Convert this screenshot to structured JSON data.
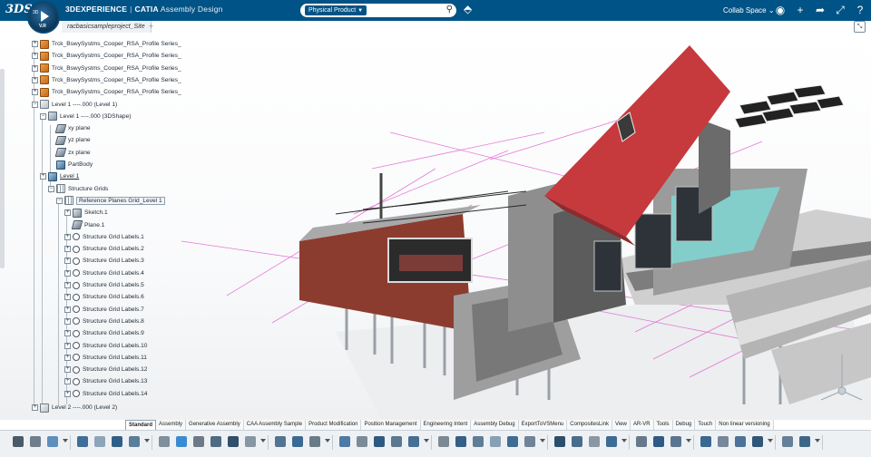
{
  "header": {
    "logo_text": "3DS",
    "compass_top": "3D",
    "compass_bottom": "V.R",
    "brand": "3DEXPERIENCE",
    "app": "CATIA",
    "workbench": "Assembly Design",
    "search_scope": "Physical Product",
    "collab_space": "Collab Space",
    "icons": [
      "user-icon",
      "plus-icon",
      "share-icon",
      "arrows-icon",
      "help-icon"
    ]
  },
  "tabs": {
    "active_tab": "racbasicsampleproject_Site",
    "add_label": "+"
  },
  "tree": {
    "nodes": [
      {
        "label": "Trck_BswySystms_Cooper_RSA_Profile Series_",
        "icon": "product",
        "expander": "+"
      },
      {
        "label": "Trck_BswySystms_Cooper_RSA_Profile Series_",
        "icon": "product",
        "expander": "+"
      },
      {
        "label": "Trck_BswySystms_Cooper_RSA_Profile Series_",
        "icon": "product",
        "expander": "+"
      },
      {
        "label": "Trck_BswySystms_Cooper_RSA_Profile Series_",
        "icon": "product",
        "expander": "+"
      },
      {
        "label": "Trck_BswySystms_Cooper_RSA_Profile Series_",
        "icon": "product",
        "expander": "+"
      },
      {
        "label": "Level 1 ----.000 (Level 1)",
        "icon": "product-small",
        "expander": "−"
      },
      {
        "label": "Level 1 ----.000 (3DShape)",
        "icon": "shape",
        "expander": "−"
      },
      {
        "label": "xy plane",
        "icon": "plane",
        "expander": ""
      },
      {
        "label": "yz plane",
        "icon": "plane",
        "expander": ""
      },
      {
        "label": "zx plane",
        "icon": "plane",
        "expander": ""
      },
      {
        "label": "PartBody",
        "icon": "body",
        "expander": ""
      },
      {
        "label": "Level 1",
        "icon": "body",
        "expander": "+"
      },
      {
        "label": "Structure Grids",
        "icon": "grid",
        "expander": "−"
      },
      {
        "label": "Reference Planes Grid_Level 1",
        "icon": "grid",
        "expander": "−"
      },
      {
        "label": "Sketch.1",
        "icon": "sketch",
        "expander": "+"
      },
      {
        "label": "Plane.1",
        "icon": "plane",
        "expander": ""
      },
      {
        "label": "Structure Grid Labels.1",
        "icon": "label",
        "expander": "+"
      },
      {
        "label": "Structure Grid Labels.2",
        "icon": "label",
        "expander": "+"
      },
      {
        "label": "Structure Grid Labels.3",
        "icon": "label",
        "expander": "+"
      },
      {
        "label": "Structure Grid Labels.4",
        "icon": "label",
        "expander": "+"
      },
      {
        "label": "Structure Grid Labels.5",
        "icon": "label",
        "expander": "+"
      },
      {
        "label": "Structure Grid Labels.6",
        "icon": "label",
        "expander": "+"
      },
      {
        "label": "Structure Grid Labels.7",
        "icon": "label",
        "expander": "+"
      },
      {
        "label": "Structure Grid Labels.8",
        "icon": "label",
        "expander": "+"
      },
      {
        "label": "Structure Grid Labels.9",
        "icon": "label",
        "expander": "+"
      },
      {
        "label": "Structure Grid Labels.10",
        "icon": "label",
        "expander": "+"
      },
      {
        "label": "Structure Grid Labels.11",
        "icon": "label",
        "expander": "+"
      },
      {
        "label": "Structure Grid Labels.12",
        "icon": "label",
        "expander": "+"
      },
      {
        "label": "Structure Grid Labels.13",
        "icon": "label",
        "expander": "+"
      },
      {
        "label": "Structure Grid Labels.14",
        "icon": "label",
        "expander": "+"
      },
      {
        "label": "Level 2 ----.000 (Level 2)",
        "icon": "product-small",
        "expander": "+"
      }
    ]
  },
  "workbench_tabs": [
    "Standard",
    "Assembly",
    "Generative Assembly",
    "CAA Assembly Sample",
    "Product Modification",
    "Position Management",
    "Engineering Intent",
    "Assembly Debug",
    "ExportToVSMenu",
    "CompositesLink",
    "View",
    "AR-VR",
    "Tools",
    "Debug",
    "Touch",
    "Non linear versioning"
  ],
  "active_workbench_tab": "Standard",
  "colors": {
    "topbar": "#005386",
    "roof": "#c6393c",
    "wall_brown": "#8c3c2f",
    "wall_grey": "#8e8e8e",
    "grid_lines": "#e57ad6",
    "glass": "#7fd7d3"
  }
}
